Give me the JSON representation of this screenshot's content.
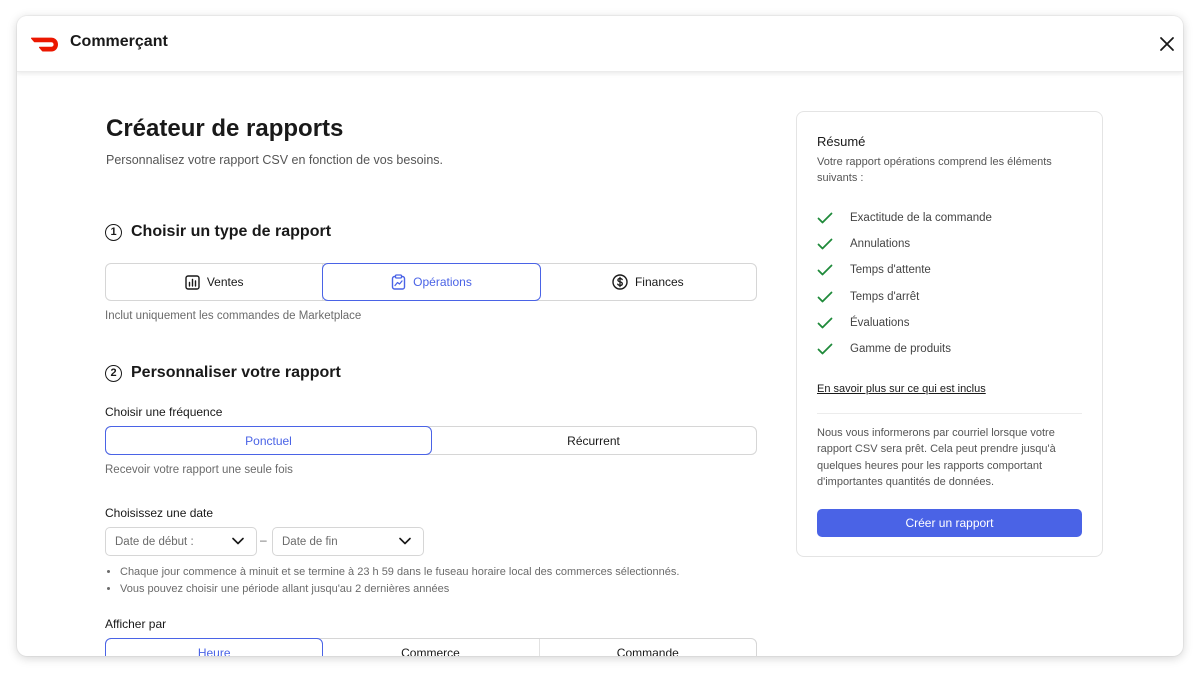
{
  "app": {
    "brand_name": "Commerçant",
    "brand_color": "#eb1700",
    "accent_color": "#4a63e6"
  },
  "page": {
    "title": "Créateur de rapports",
    "subtitle": "Personnalisez votre rapport CSV en fonction de vos besoins."
  },
  "step1": {
    "number": "1",
    "title": "Choisir un type de rapport",
    "options": [
      {
        "label": "Ventes",
        "icon": "bar-chart-icon",
        "selected": false
      },
      {
        "label": "Opérations",
        "icon": "clipboard-chart-icon",
        "selected": true
      },
      {
        "label": "Finances",
        "icon": "dollar-circle-icon",
        "selected": false
      }
    ],
    "helper": "Inclut uniquement les commandes de Marketplace"
  },
  "step2": {
    "number": "2",
    "title": "Personnaliser votre rapport",
    "frequency": {
      "label": "Choisir une fréquence",
      "options": [
        {
          "label": "Ponctuel",
          "selected": true
        },
        {
          "label": "Récurrent",
          "selected": false
        }
      ],
      "helper": "Recevoir votre rapport une seule fois"
    },
    "date": {
      "label": "Choisissez une date",
      "start_placeholder": "Date de début :",
      "separator": "–",
      "end_placeholder": "Date de fin",
      "notes": [
        "Chaque jour commence à minuit et se termine à 23 h 59 dans le fuseau horaire local des commerces sélectionnés.",
        "Vous pouvez choisir une période allant jusqu'au 2 dernières années"
      ]
    },
    "display_by": {
      "label": "Afficher par",
      "options": [
        {
          "label": "Heure",
          "selected": true
        },
        {
          "label": "Commerce",
          "selected": false
        },
        {
          "label": "Commande",
          "selected": false
        }
      ]
    }
  },
  "summary": {
    "title": "Résumé",
    "description": "Votre rapport opérations comprend les éléments suivants :",
    "items": [
      "Exactitude de la commande",
      "Annulations",
      "Temps d'attente",
      "Temps d'arrêt",
      "Évaluations",
      "Gamme de produits"
    ],
    "check_color": "#1f8a3a",
    "learn_more": "En savoir plus sur ce qui est inclus",
    "notice": "Nous vous informerons par courriel lorsque votre rapport CSV sera prêt. Cela peut prendre jusqu'à quelques heures pour les rapports comportant d'importantes quantités de données.",
    "create_button": "Créer un rapport"
  }
}
